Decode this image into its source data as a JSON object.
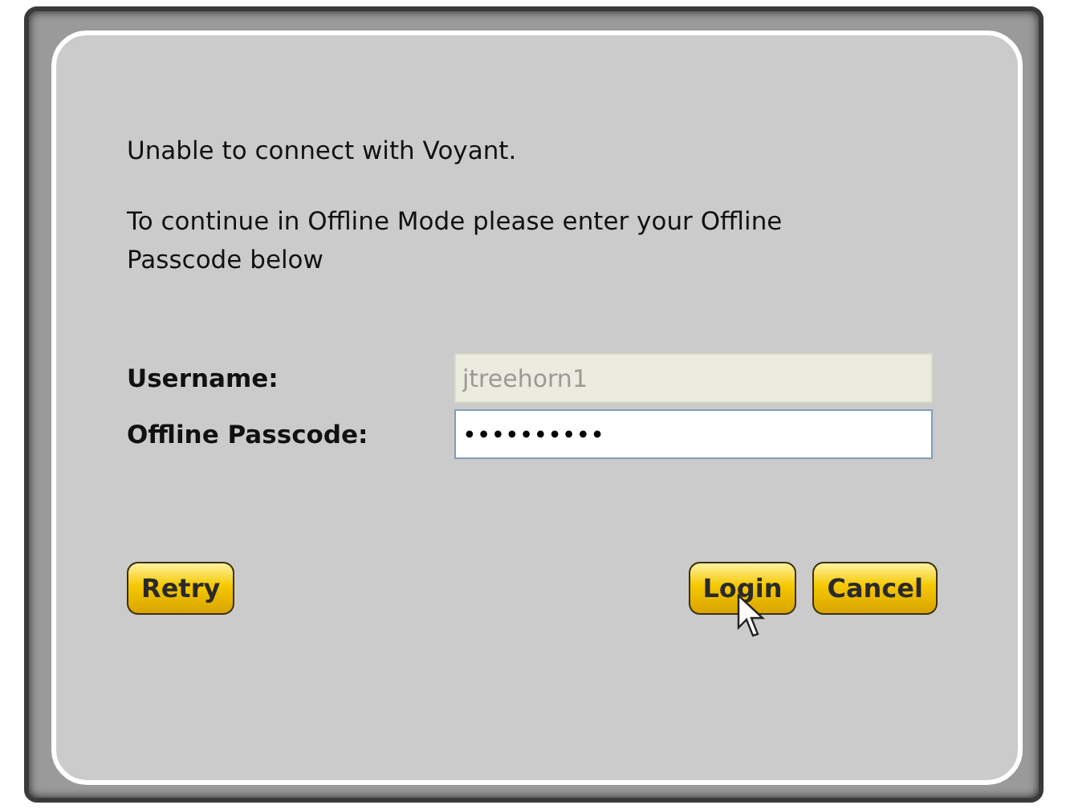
{
  "message": {
    "lines": [
      "Unable to connect with Voyant.",
      "To continue in Offline Mode please enter your Offline Passcode below"
    ]
  },
  "fields": [
    {
      "label": "Username:",
      "value": "jtreehorn1",
      "disabled": true
    },
    {
      "label": "Offline Passcode:",
      "value": "••••••••••",
      "disabled": false
    }
  ],
  "buttons": {
    "left": [
      "Retry"
    ],
    "right": [
      "Login",
      "Cancel"
    ]
  }
}
